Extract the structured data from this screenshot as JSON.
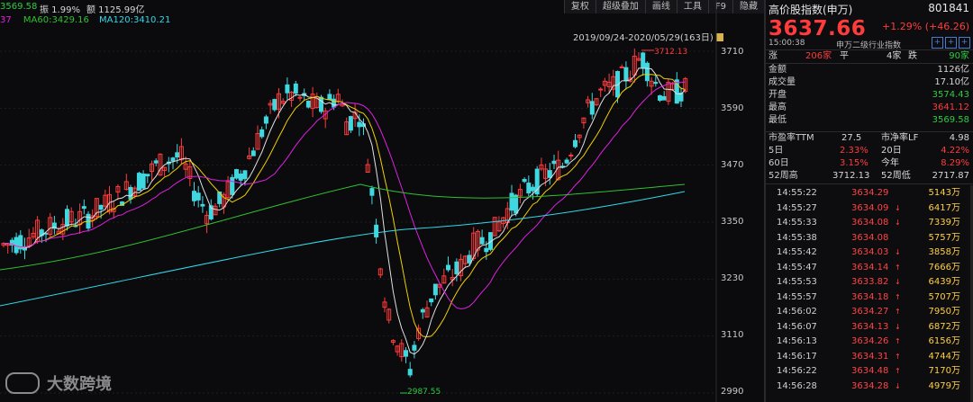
{
  "topbar": {
    "low": "3569.58",
    "amplitude": "振 1.99%",
    "amount": "额 1125.99亿"
  },
  "toolbar": [
    "复权",
    "超级叠加",
    "画线",
    "工具",
    "F9",
    "隐藏"
  ],
  "ma": {
    "ma_prefix": "37",
    "ma60": "MA60:3429.16",
    "ma120": "MA120:3410.21"
  },
  "range_text": "2019/09/24-2020/05/29(163日)",
  "yaxis": [
    "3710",
    "3590",
    "3470",
    "3350",
    "3230",
    "3110",
    "2990"
  ],
  "markers": {
    "high": "3712.13",
    "low": "2987.55"
  },
  "watermark": "大数跨境",
  "colors": {
    "up": "#ff3b3b",
    "down": "#3fd8e0",
    "ma5": "#e0e0e0",
    "ma10": "#f0d000",
    "ma20": "#e020e0",
    "ma60": "#30c030",
    "ma120": "#30d8e8"
  },
  "panel": {
    "title": "高价股指数(申万)",
    "code": "801841",
    "price": "3637.66",
    "change": "+1.29% (+46.26)",
    "time": "15:00:38",
    "category": "申万二级行业指数",
    "btns": [
      "+",
      "+",
      "+"
    ],
    "breadth": {
      "up_label": "涨",
      "up": "206家",
      "flat_label": "平",
      "flat": "4家",
      "down_label": "跌",
      "down": "90家"
    },
    "stats": [
      {
        "label": "金额",
        "value": "1126亿",
        "color": "white"
      },
      {
        "label": "成交量",
        "value": "17.10亿",
        "color": "white"
      },
      {
        "label": "开盘",
        "value": "3574.43",
        "color": "green"
      },
      {
        "label": "最高",
        "value": "3641.12",
        "color": "red"
      },
      {
        "label": "最低",
        "value": "3569.58",
        "color": "green"
      }
    ],
    "ratios": {
      "pe_label": "市盈率TTM",
      "pe": "27.5",
      "pb_label": "市净率LF",
      "pb": "4.98",
      "d5_label": "5日",
      "d5": "2.33%",
      "d20_label": "20日",
      "d20": "4.22%",
      "d60_label": "60日",
      "d60": "3.15%",
      "ytd_label": "今年",
      "ytd": "8.29%",
      "h52_label": "52周高",
      "h52": "3712.13",
      "l52_label": "52周低",
      "l52": "2717.87"
    },
    "ticks": [
      {
        "time": "14:55:22",
        "price": "3634.29",
        "vol": "5143万",
        "arrow": ""
      },
      {
        "time": "14:55:27",
        "price": "3634.09",
        "vol": "6417万",
        "arrow": "↓"
      },
      {
        "time": "14:55:33",
        "price": "3634.08",
        "vol": "7339万",
        "arrow": "↓"
      },
      {
        "time": "14:55:38",
        "price": "3634.08",
        "vol": "5757万",
        "arrow": ""
      },
      {
        "time": "14:55:42",
        "price": "3634.03",
        "vol": "3858万",
        "arrow": "↓"
      },
      {
        "time": "14:55:47",
        "price": "3634.14",
        "vol": "7666万",
        "arrow": "↑"
      },
      {
        "time": "14:55:53",
        "price": "3633.82",
        "vol": "6439万",
        "arrow": "↓"
      },
      {
        "time": "14:55:57",
        "price": "3634.18",
        "vol": "5707万",
        "arrow": "↑"
      },
      {
        "time": "14:56:02",
        "price": "3634.27",
        "vol": "7950万",
        "arrow": "↑"
      },
      {
        "time": "14:56:07",
        "price": "3634.13",
        "vol": "6872万",
        "arrow": "↓"
      },
      {
        "time": "14:56:13",
        "price": "3634.26",
        "vol": "6156万",
        "arrow": "↑"
      },
      {
        "time": "14:56:17",
        "price": "3634.31",
        "vol": "4744万",
        "arrow": "↑"
      },
      {
        "time": "14:56:22",
        "price": "3634.48",
        "vol": "7170万",
        "arrow": "↑"
      },
      {
        "time": "14:56:28",
        "price": "3634.28",
        "vol": "4979万",
        "arrow": "↓"
      }
    ]
  }
}
